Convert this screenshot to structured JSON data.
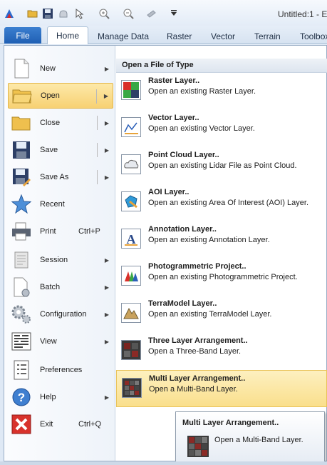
{
  "window": {
    "title": "Untitled:1 - E"
  },
  "qat": [
    "app-logo-icon",
    "open-folder-icon",
    "save-icon",
    "pan-icon",
    "select-icon",
    "zoom-in-icon",
    "zoom-out-icon",
    "inquire-icon",
    "customize-icon"
  ],
  "ribbon": {
    "file": "File",
    "tabs": [
      "Home",
      "Manage Data",
      "Raster",
      "Vector",
      "Terrain",
      "Toolbox"
    ]
  },
  "menu": {
    "items": [
      {
        "label": "New",
        "shortcut": "",
        "submenu": true,
        "icon": "new-document-icon"
      },
      {
        "label": "Open",
        "shortcut": "",
        "submenu": true,
        "icon": "open-folder-icon",
        "active": true
      },
      {
        "label": "Close",
        "shortcut": "",
        "submenu": true,
        "icon": "close-folder-icon"
      },
      {
        "label": "Save",
        "shortcut": "",
        "submenu": true,
        "icon": "save-icon"
      },
      {
        "label": "Save As",
        "shortcut": "",
        "submenu": true,
        "icon": "save-as-icon"
      },
      {
        "label": "Recent",
        "shortcut": "",
        "submenu": false,
        "icon": "recent-star-icon"
      },
      {
        "label": "Print",
        "shortcut": "Ctrl+P",
        "submenu": false,
        "icon": "printer-icon"
      },
      {
        "label": "Session",
        "shortcut": "",
        "submenu": true,
        "icon": "session-scroll-icon"
      },
      {
        "label": "Batch",
        "shortcut": "",
        "submenu": true,
        "icon": "batch-icon"
      },
      {
        "label": "Configuration",
        "shortcut": "",
        "submenu": true,
        "icon": "configuration-gears-icon"
      },
      {
        "label": "View",
        "shortcut": "",
        "submenu": true,
        "icon": "view-icon"
      },
      {
        "label": "Preferences",
        "shortcut": "",
        "submenu": false,
        "icon": "preferences-icon"
      },
      {
        "label": "Help",
        "shortcut": "",
        "submenu": true,
        "icon": "help-icon"
      },
      {
        "label": "Exit",
        "shortcut": "Ctrl+Q",
        "submenu": false,
        "icon": "exit-icon"
      }
    ]
  },
  "open_panel": {
    "header": "Open a File of Type",
    "items": [
      {
        "title": "Raster Layer..",
        "desc": "Open an existing Raster Layer.",
        "icon": "raster-layer-icon"
      },
      {
        "title": "Vector Layer..",
        "desc": "Open an existing Vector Layer.",
        "icon": "vector-layer-icon"
      },
      {
        "title": "Point Cloud Layer..",
        "desc": "Open an existing Lidar File as Point Cloud.",
        "icon": "point-cloud-layer-icon"
      },
      {
        "title": "AOI Layer..",
        "desc": "Open an existing Area Of Interest (AOI) Layer.",
        "icon": "aoi-layer-icon"
      },
      {
        "title": "Annotation Layer..",
        "desc": "Open an existing Annotation Layer.",
        "icon": "annotation-layer-icon"
      },
      {
        "title": "Photogrammetric Project..",
        "desc": "Open an existing Photogrammetric Project.",
        "icon": "photogrammetric-project-icon"
      },
      {
        "title": "TerraModel Layer..",
        "desc": "Open an existing TerraModel Layer.",
        "icon": "terramodel-layer-icon"
      },
      {
        "title": "Three Layer Arrangement..",
        "desc": "Open a Three-Band Layer.",
        "icon": "three-layer-arrangement-icon"
      },
      {
        "title": "Multi Layer Arrangement..",
        "desc": "Open a Multi-Band Layer.",
        "icon": "multi-layer-arrangement-icon",
        "highlighted": true
      }
    ]
  },
  "tooltip": {
    "title": "Multi Layer Arrangement..",
    "desc": "Open a Multi-Band Layer.",
    "icon": "multi-layer-arrangement-icon"
  }
}
